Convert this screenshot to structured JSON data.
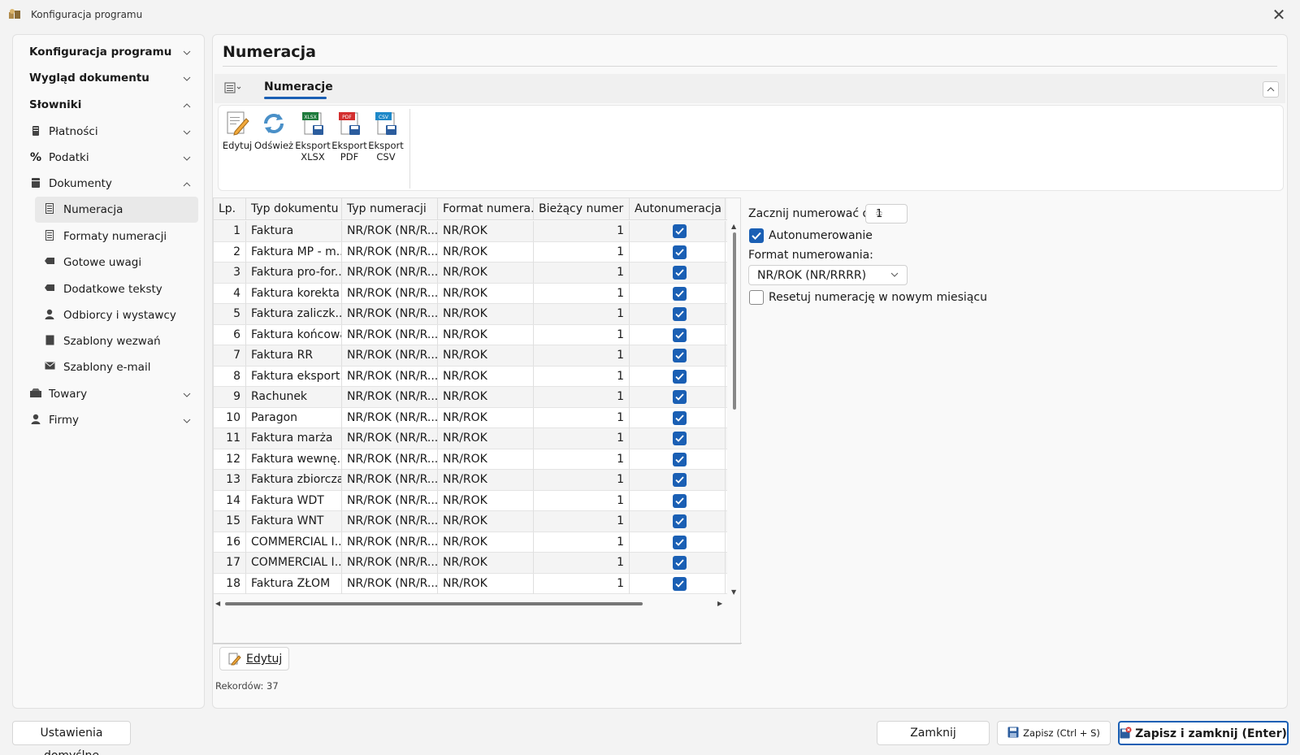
{
  "window": {
    "title": "Konfiguracja programu",
    "close_glyph": "✕"
  },
  "sidebar": {
    "items": [
      {
        "label": "Konfiguracja programu",
        "level": 0,
        "chevron": "down"
      },
      {
        "label": "Wygląd dokumentu",
        "level": 0,
        "chevron": "down"
      },
      {
        "label": "Słowniki",
        "level": 0,
        "chevron": "up"
      },
      {
        "label": "Płatności",
        "level": 1,
        "icon": "payment-icon",
        "chevron": "down"
      },
      {
        "label": "Podatki",
        "level": 1,
        "icon": "percent-icon",
        "chevron": "down"
      },
      {
        "label": "Dokumenty",
        "level": 1,
        "icon": "document-icon",
        "chevron": "up"
      },
      {
        "label": "Numeracja",
        "level": 2,
        "icon": "numbering-icon",
        "selected": true
      },
      {
        "label": "Formaty numeracji",
        "level": 2,
        "icon": "format-icon"
      },
      {
        "label": "Gotowe uwagi",
        "level": 2,
        "icon": "note-tag-icon"
      },
      {
        "label": "Dodatkowe teksty",
        "level": 2,
        "icon": "text-tag-icon"
      },
      {
        "label": "Odbiorcy i wystawcy",
        "level": 2,
        "icon": "person-icon"
      },
      {
        "label": "Szablony wezwań",
        "level": 2,
        "icon": "template-icon"
      },
      {
        "label": "Szablony e-mail",
        "level": 2,
        "icon": "mail-icon"
      },
      {
        "label": "Towary",
        "level": 1,
        "icon": "boxes-icon",
        "chevron": "down"
      },
      {
        "label": "Firmy",
        "level": 1,
        "icon": "person-icon",
        "chevron": "down"
      }
    ]
  },
  "main": {
    "title": "Numeracja",
    "tab": "Numeracje",
    "ribbon": [
      {
        "label": "Edytuj",
        "icon": "edit-icon"
      },
      {
        "label": "Odśwież",
        "icon": "refresh-icon"
      },
      {
        "label": "Eksport XLSX",
        "line1": "Eksport",
        "line2": "XLSX",
        "icon": "export-xlsx-icon",
        "badge": "XLSX",
        "color": "#1e7b3c"
      },
      {
        "label": "Eksport PDF",
        "line1": "Eksport",
        "line2": "PDF",
        "icon": "export-pdf-icon",
        "badge": "PDF",
        "color": "#d32f2f"
      },
      {
        "label": "Eksport CSV",
        "line1": "Eksport",
        "line2": "CSV",
        "icon": "export-csv-icon",
        "badge": "CSV",
        "color": "#1e88c8"
      }
    ],
    "table": {
      "columns": [
        "Lp.",
        "Typ dokumentu",
        "Typ numeracji",
        "Format numera...",
        "Bieżący numer",
        "Autonumeracja"
      ],
      "rows": [
        {
          "lp": "1",
          "typ": "Faktura",
          "typ_num": "NR/ROK (NR/R...",
          "format": "NR/ROK",
          "numer": "1",
          "auto": true
        },
        {
          "lp": "2",
          "typ": "Faktura MP - m...",
          "typ_num": "NR/ROK (NR/R...",
          "format": "NR/ROK",
          "numer": "1",
          "auto": true
        },
        {
          "lp": "3",
          "typ": "Faktura pro-for...",
          "typ_num": "NR/ROK (NR/R...",
          "format": "NR/ROK",
          "numer": "1",
          "auto": true
        },
        {
          "lp": "4",
          "typ": "Faktura korekta",
          "typ_num": "NR/ROK (NR/R...",
          "format": "NR/ROK",
          "numer": "1",
          "auto": true
        },
        {
          "lp": "5",
          "typ": "Faktura zaliczk...",
          "typ_num": "NR/ROK (NR/R...",
          "format": "NR/ROK",
          "numer": "1",
          "auto": true
        },
        {
          "lp": "6",
          "typ": "Faktura końcowa",
          "typ_num": "NR/ROK (NR/R...",
          "format": "NR/ROK",
          "numer": "1",
          "auto": true
        },
        {
          "lp": "7",
          "typ": "Faktura RR",
          "typ_num": "NR/ROK (NR/R...",
          "format": "NR/ROK",
          "numer": "1",
          "auto": true
        },
        {
          "lp": "8",
          "typ": "Faktura eksport...",
          "typ_num": "NR/ROK (NR/R...",
          "format": "NR/ROK",
          "numer": "1",
          "auto": true
        },
        {
          "lp": "9",
          "typ": "Rachunek",
          "typ_num": "NR/ROK (NR/R...",
          "format": "NR/ROK",
          "numer": "1",
          "auto": true
        },
        {
          "lp": "10",
          "typ": "Paragon",
          "typ_num": "NR/ROK (NR/R...",
          "format": "NR/ROK",
          "numer": "1",
          "auto": true
        },
        {
          "lp": "11",
          "typ": "Faktura marża",
          "typ_num": "NR/ROK (NR/R...",
          "format": "NR/ROK",
          "numer": "1",
          "auto": true
        },
        {
          "lp": "12",
          "typ": "Faktura wewnę...",
          "typ_num": "NR/ROK (NR/R...",
          "format": "NR/ROK",
          "numer": "1",
          "auto": true
        },
        {
          "lp": "13",
          "typ": "Faktura zbiorcza",
          "typ_num": "NR/ROK (NR/R...",
          "format": "NR/ROK",
          "numer": "1",
          "auto": true
        },
        {
          "lp": "14",
          "typ": "Faktura WDT",
          "typ_num": "NR/ROK (NR/R...",
          "format": "NR/ROK",
          "numer": "1",
          "auto": true
        },
        {
          "lp": "15",
          "typ": "Faktura WNT",
          "typ_num": "NR/ROK (NR/R...",
          "format": "NR/ROK",
          "numer": "1",
          "auto": true
        },
        {
          "lp": "16",
          "typ": "COMMERCIAL I...",
          "typ_num": "NR/ROK (NR/R...",
          "format": "NR/ROK",
          "numer": "1",
          "auto": true
        },
        {
          "lp": "17",
          "typ": "COMMERCIAL I...",
          "typ_num": "NR/ROK (NR/R...",
          "format": "NR/ROK",
          "numer": "1",
          "auto": true
        },
        {
          "lp": "18",
          "typ": "Faktura ZŁOM",
          "typ_num": "NR/ROK (NR/R...",
          "format": "NR/ROK",
          "numer": "1",
          "auto": true
        }
      ]
    },
    "details": {
      "start_label": "Zacznij numerować od:",
      "start_value": "1",
      "auto_label": "Autonumerowanie",
      "auto_checked": true,
      "format_label": "Format numerowania:",
      "format_value": "NR/ROK (NR/RRRR)",
      "reset_label": "Resetuj numerację w nowym miesiącu",
      "reset_checked": false
    },
    "edit_button": "Edytuj",
    "records": "Rekordów: 37"
  },
  "footer": {
    "defaults": "Ustawienia domyślne",
    "close": "Zamknij",
    "save": "Zapisz (Ctrl + S)",
    "save_close": "Zapisz i zamknij (Enter)"
  },
  "colors": {
    "accent": "#1a5fb4",
    "row_alt": "#f4f4f4"
  }
}
